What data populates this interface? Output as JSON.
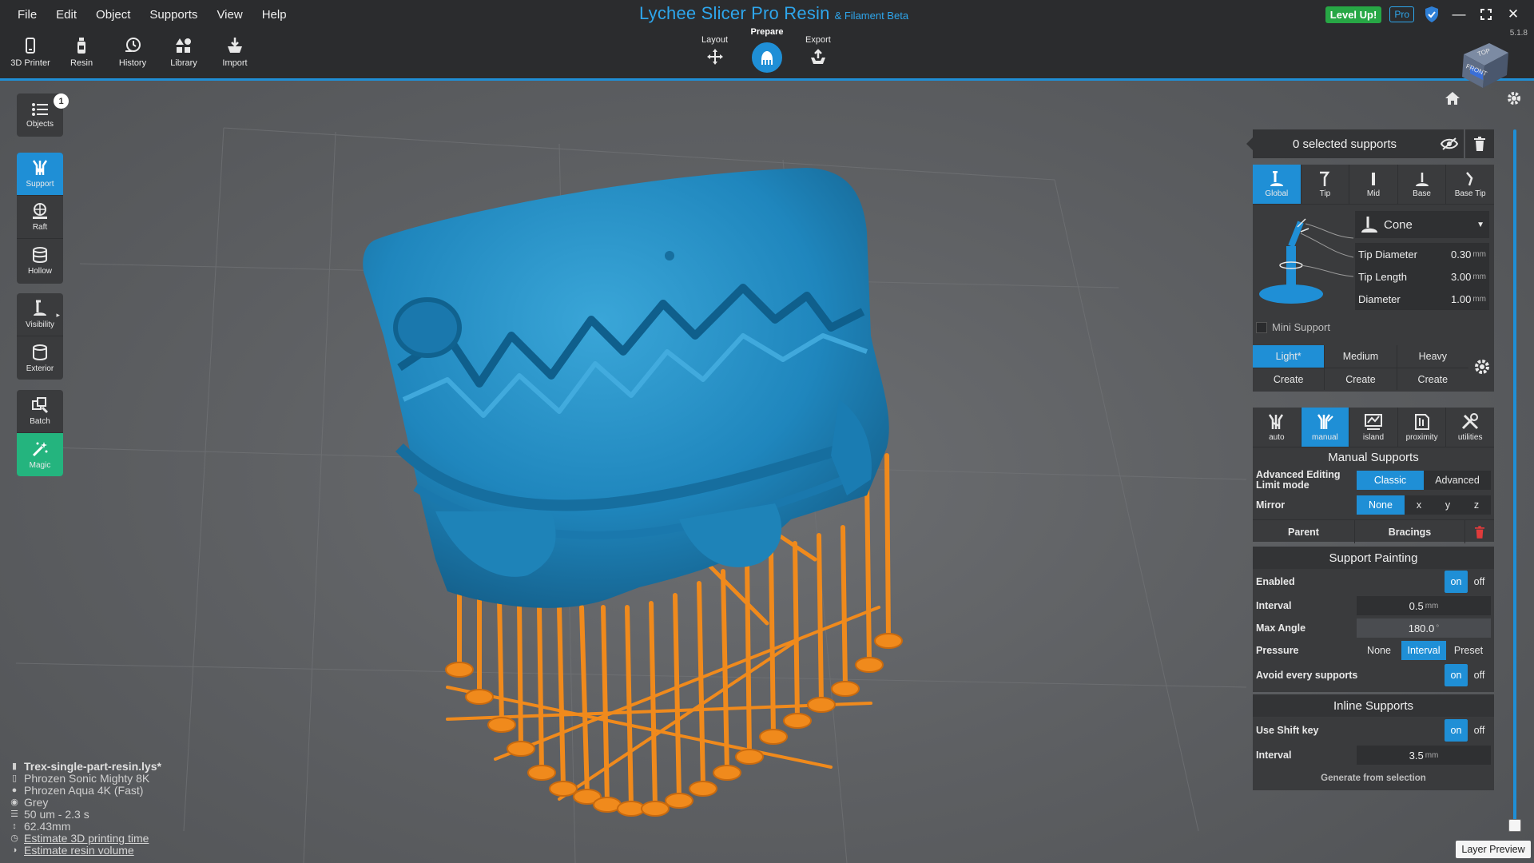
{
  "menu": [
    "File",
    "Edit",
    "Object",
    "Supports",
    "View",
    "Help"
  ],
  "app": {
    "title": "Lychee Slicer Pro Resin",
    "subtitle": "& Filament Beta",
    "version": "5.1.8",
    "level_up": "Level Up!",
    "pro": "Pro"
  },
  "toolbar": [
    {
      "label": "3D Printer",
      "icon": "printer-icon"
    },
    {
      "label": "Resin",
      "icon": "resin-bottle-icon"
    },
    {
      "label": "History",
      "icon": "history-icon"
    },
    {
      "label": "Library",
      "icon": "library-icon"
    },
    {
      "label": "Import",
      "icon": "import-icon"
    }
  ],
  "stages": {
    "layout": "Layout",
    "prepare": "Prepare",
    "export": "Export",
    "active": "prepare"
  },
  "viewcube": {
    "top": "TOP",
    "front": "FRONT"
  },
  "sidebar": {
    "objects": {
      "label": "Objects",
      "count": "1"
    },
    "support": "Support",
    "raft": "Raft",
    "hollow": "Hollow",
    "visibility": "Visibility",
    "exterior": "Exterior",
    "batch": "Batch",
    "magic": "Magic"
  },
  "info": {
    "file": "Trex-single-part-resin.lys*",
    "printer": "Phrozen Sonic Mighty 8K",
    "resin": "Phrozen Aqua 4K (Fast)",
    "color": "Grey",
    "layers": "50 um - 2.3 s",
    "height": "62.43mm",
    "estimate_time": "Estimate 3D printing time",
    "estimate_volume": "Estimate resin volume"
  },
  "support_panel": {
    "selected": "0 selected supports",
    "tabs": [
      "Global",
      "Tip",
      "Mid",
      "Base",
      "Base Tip"
    ],
    "shape": "Cone",
    "params": [
      {
        "name": "Tip Diameter",
        "value": "0.30",
        "unit": "mm"
      },
      {
        "name": "Tip Length",
        "value": "3.00",
        "unit": "mm"
      },
      {
        "name": "Diameter",
        "value": "1.00",
        "unit": "mm"
      }
    ],
    "mini_support": "Mini Support",
    "presets": [
      "Light*",
      "Medium",
      "Heavy"
    ],
    "create": "Create"
  },
  "modes_panel": {
    "tabs": [
      "auto",
      "manual",
      "island",
      "proximity",
      "utilities"
    ],
    "title": "Manual Supports",
    "advanced_label": "Advanced Editing Limit mode",
    "advanced_options": [
      "Classic",
      "Advanced"
    ],
    "mirror_label": "Mirror",
    "mirror_options": [
      "None",
      "x",
      "y",
      "z"
    ],
    "parent": "Parent",
    "bracings": "Bracings"
  },
  "painting": {
    "title": "Support Painting",
    "enabled": "Enabled",
    "on": "on",
    "off": "off",
    "interval_label": "Interval",
    "interval_value": "0.5",
    "interval_unit": "mm",
    "max_angle_label": "Max Angle",
    "max_angle_value": "180.0",
    "max_angle_unit": "°",
    "pressure_label": "Pressure",
    "pressure_options": [
      "None",
      "Interval",
      "Preset"
    ],
    "avoid_label": "Avoid every supports"
  },
  "inline": {
    "title": "Inline Supports",
    "shift_label": "Use Shift key",
    "interval_label": "Interval",
    "interval_value": "3.5",
    "interval_unit": "mm",
    "generate": "Generate from selection"
  },
  "layer_preview": "Layer Preview",
  "colors": {
    "accent": "#1f8fd6",
    "model": "#2b8fc0",
    "supports": "#f08a1c",
    "magic": "#24b47e"
  }
}
